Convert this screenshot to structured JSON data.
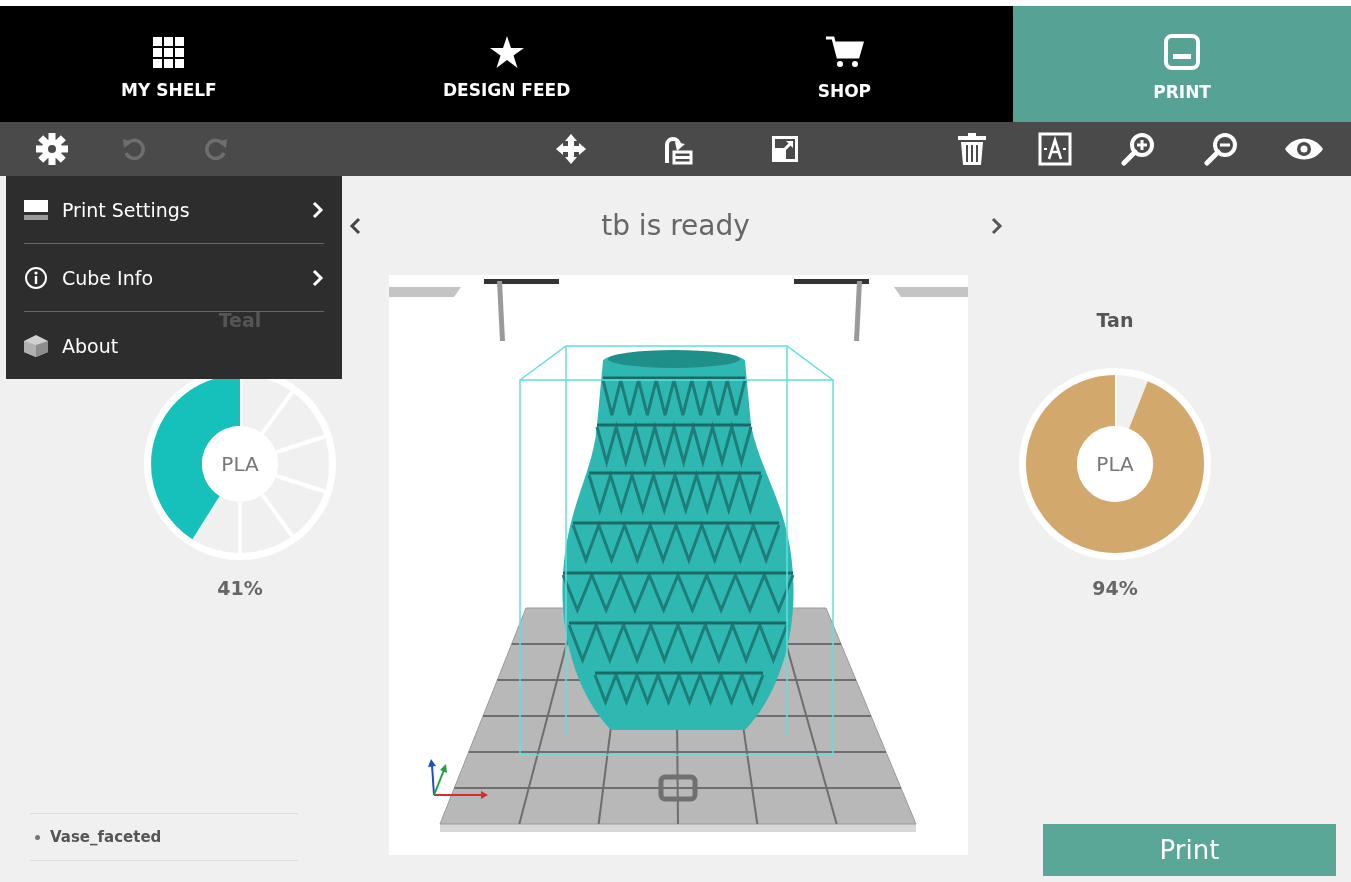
{
  "nav_tabs": [
    {
      "label": "MY SHELF",
      "selected": false
    },
    {
      "label": "DESIGN FEED",
      "selected": false
    },
    {
      "label": "SHOP",
      "selected": false
    },
    {
      "label": "PRINT",
      "selected": true
    }
  ],
  "toolbar": {
    "left": [
      {
        "disabled": false
      },
      {
        "disabled": true
      },
      {
        "disabled": true
      }
    ],
    "center": [
      {
        "disabled": false
      },
      {
        "disabled": false
      },
      {
        "disabled": false
      }
    ],
    "right": [
      {
        "disabled": false
      },
      {
        "disabled": false
      },
      {
        "disabled": false
      },
      {
        "disabled": false
      },
      {
        "disabled": false
      }
    ]
  },
  "settings_menu": {
    "items": [
      {
        "label": "Print Settings",
        "submenu": true
      },
      {
        "label": "Cube Info",
        "submenu": true
      },
      {
        "label": "About",
        "submenu": false
      }
    ]
  },
  "printer_title": "tb is ready",
  "cartridges": [
    {
      "name": "Teal",
      "material": "PLA",
      "level": 0.41,
      "reading": "41%",
      "color": "#17c1bb"
    },
    {
      "name": "Tan",
      "material": "PLA",
      "level": 0.94,
      "reading": "94%",
      "color": "#d3a86d"
    }
  ],
  "models": [
    "Vase_faceted"
  ],
  "print_button": "Print"
}
